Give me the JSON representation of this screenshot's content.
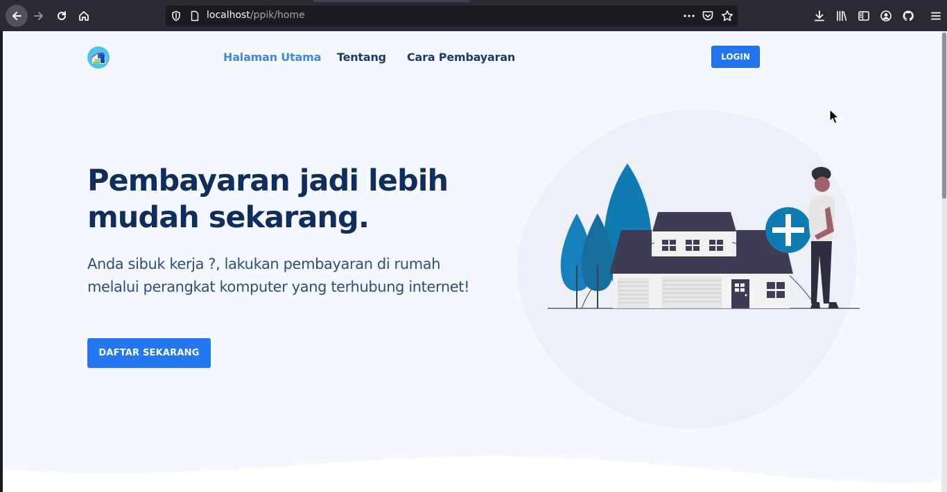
{
  "browser": {
    "url_host": "localhost",
    "url_path": "/ppik/home",
    "icons": [
      "back-icon",
      "forward-icon",
      "reload-icon",
      "home-icon",
      "shield-icon",
      "page-icon",
      "more-icon",
      "pocket-icon",
      "bookmark-star-icon",
      "download-icon",
      "library-icon",
      "sidebar-icon",
      "account-icon",
      "github-icon",
      "menu-icon"
    ]
  },
  "nav": {
    "items": [
      {
        "label": "Halaman Utama",
        "active": true
      },
      {
        "label": "Tentang",
        "active": false
      },
      {
        "label": "Cara Pembayaran",
        "active": false
      }
    ],
    "login_label": "LOGIN"
  },
  "hero": {
    "title": "Pembayaran jadi lebih mudah sekarang.",
    "subtitle": "Anda sibuk kerja ?, lakukan pembayaran di rumah melalui perangkat komputer yang terhubung internet!",
    "cta_label": "DAFTAR SEKARANG"
  },
  "colors": {
    "accent": "#2377ef",
    "nav_active": "#4088e0",
    "heading": "#0f2e5c",
    "background": "#f5f8fe"
  }
}
